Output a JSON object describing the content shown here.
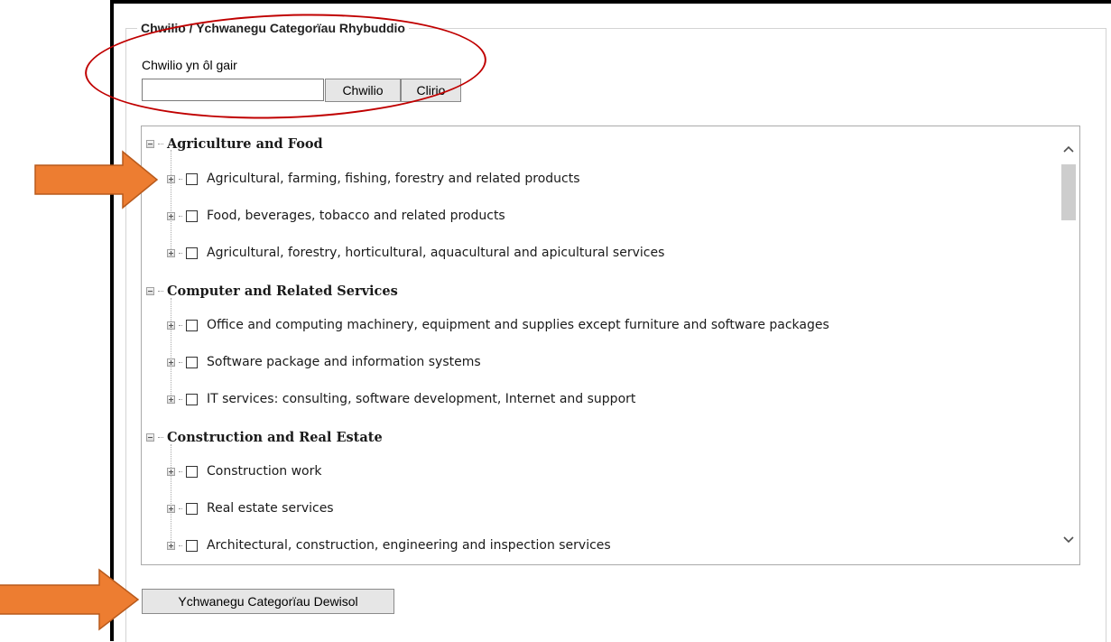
{
  "panel": {
    "legend": "Chwilio / Ychwanegu Categorïau Rhybuddio"
  },
  "search": {
    "label": "Chwilio yn ôl gair",
    "value": "",
    "placeholder": "",
    "search_button": "Chwilio",
    "clear_button": "Clirio"
  },
  "tree": {
    "categories": [
      {
        "label": "Agriculture and Food",
        "items": [
          "Agricultural, farming, fishing, forestry and related products",
          "Food, beverages, tobacco and related products",
          "Agricultural, forestry, horticultural, aquacultural and apicultural services"
        ]
      },
      {
        "label": "Computer and Related Services",
        "items": [
          "Office and computing machinery, equipment and supplies except furniture and software packages",
          "Software package and information systems",
          "IT services: consulting, software development, Internet and support"
        ]
      },
      {
        "label": "Construction and Real Estate",
        "items": [
          "Construction work",
          "Real estate services",
          "Architectural, construction, engineering and inspection services"
        ]
      }
    ]
  },
  "actions": {
    "add_selected": "Ychwanegu Categorïau Dewisol"
  },
  "colors": {
    "annotation_arrow": "#ed7d31",
    "annotation_ellipse": "#c00000"
  }
}
